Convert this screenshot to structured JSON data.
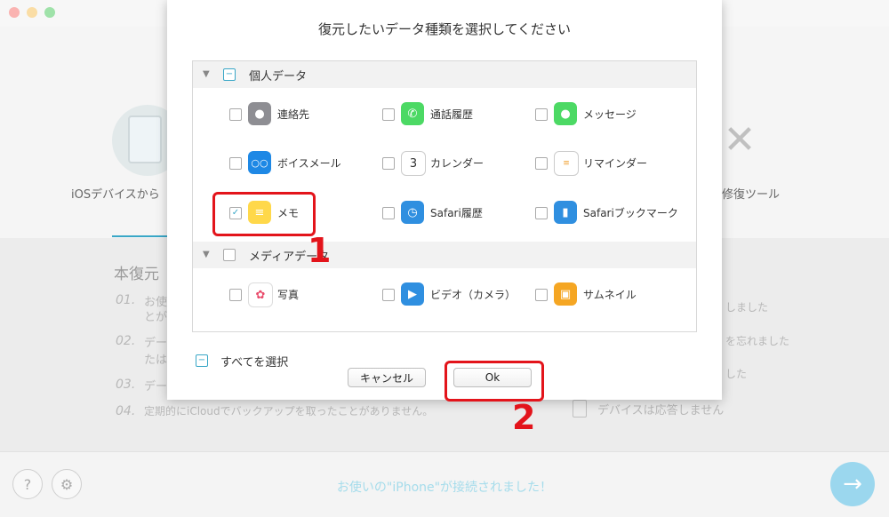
{
  "background": {
    "left_mode_label": "iOSデバイスから",
    "right_mode_label": "修復ツール",
    "section_title": "本復元",
    "left_list": [
      {
        "num": "01.",
        "text": "お使",
        "text2": "とが"
      },
      {
        "num": "02.",
        "text": "デー",
        "text2": "たは"
      },
      {
        "num": "03.",
        "text": "デー"
      },
      {
        "num": "04.",
        "text": "定期的にiCloudでバックアップを取ったことがありません。"
      }
    ],
    "right_list": [
      "しました",
      "を忘れました",
      "した",
      "デバイスは応答しません"
    ],
    "status": "お使いの\"iPhone\"が接続されました！"
  },
  "dialog": {
    "title": "復元したいデータ種類を選択してください",
    "categories": [
      {
        "label": "個人データ",
        "state": "−"
      },
      {
        "label": "メディアデータ",
        "state": ""
      }
    ],
    "personal_items": [
      {
        "label": "連絡先",
        "icon": "contacts-icon",
        "color": "#8e8e93",
        "checked": ""
      },
      {
        "label": "通話履歴",
        "icon": "phone-icon",
        "color": "#4cd964",
        "checked": ""
      },
      {
        "label": "メッセージ",
        "icon": "messages-icon",
        "color": "#4cd964",
        "checked": ""
      },
      {
        "label": "ボイスメール",
        "icon": "voicemail-icon",
        "color": "#1e88e5",
        "checked": ""
      },
      {
        "label": "カレンダー",
        "icon": "calendar-icon",
        "color": "#ffffff",
        "checked": ""
      },
      {
        "label": "リマインダー",
        "icon": "reminders-icon",
        "color": "#ffffff",
        "checked": ""
      },
      {
        "label": "メモ",
        "icon": "notes-icon",
        "color": "#ffd84a",
        "checked": "✓"
      },
      {
        "label": "Safari履歴",
        "icon": "safari-history-icon",
        "color": "#2f8fe0",
        "checked": ""
      },
      {
        "label": "Safariブックマーク",
        "icon": "safari-bookmark-icon",
        "color": "#2f8fe0",
        "checked": ""
      }
    ],
    "media_items": [
      {
        "label": "写真",
        "icon": "photos-icon",
        "color": "#ffffff",
        "checked": ""
      },
      {
        "label": "ビデオ（カメラ）",
        "icon": "video-icon",
        "color": "#2f8fe0",
        "checked": ""
      },
      {
        "label": "サムネイル",
        "icon": "thumbnail-icon",
        "color": "#f5a623",
        "checked": ""
      }
    ],
    "calendar_day": "3",
    "select_all_label": "すべてを選択",
    "select_all_state": "−",
    "cancel_label": "キャンセル",
    "ok_label": "Ok"
  },
  "annotations": {
    "step1": "1",
    "step2": "2"
  },
  "colors": {
    "accent": "#39a7c7",
    "annotation_red": "#e3141b",
    "next_button": "#9bd7ee"
  }
}
